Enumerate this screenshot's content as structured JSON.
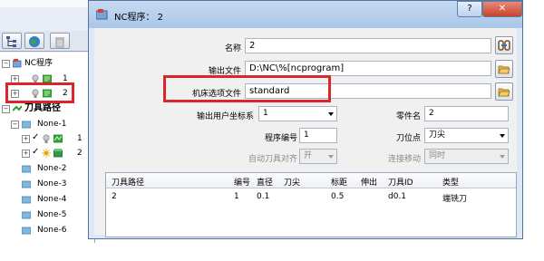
{
  "tree": {
    "root_label": "NC程序",
    "nc_items": [
      {
        "label": "1"
      },
      {
        "label": "2"
      }
    ],
    "toolpaths_label": "刀具路径",
    "toolpath_items": [
      {
        "label": "None-1",
        "children": [
          {
            "label": "1"
          },
          {
            "label": "2"
          }
        ]
      },
      {
        "label": "None-2"
      },
      {
        "label": "None-3"
      },
      {
        "label": "None-4"
      },
      {
        "label": "None-5"
      },
      {
        "label": "None-6"
      }
    ]
  },
  "dialog": {
    "title": "NC程序：   2",
    "help_label": "?",
    "close_label": "✕",
    "name_label": "名称",
    "name_value": "2",
    "output_file_label": "输出文件",
    "output_file_value": "D:\\NC\\%[ncprogram]",
    "machine_option_label": "机床选项文件",
    "machine_option_value": "standard",
    "user_coord_label": "输出用户坐标系",
    "user_coord_value": "1",
    "part_name_label": "零件名",
    "part_name_value": "2",
    "program_number_label": "程序编号",
    "program_number_value": "1",
    "tool_position_label": "刀位点",
    "tool_position_value": "刀尖",
    "auto_tool_align_label": "自动刀具对齐",
    "auto_tool_align_value": "开",
    "connect_move_label": "连接移动",
    "connect_move_value": "同时"
  },
  "table": {
    "columns": [
      "刀具路径",
      "编号",
      "直径",
      "刀尖",
      "标距",
      "伸出",
      "刀具ID",
      "类型"
    ],
    "rows": [
      [
        "2",
        "1",
        "0.1",
        "",
        "0.5",
        "",
        "d0.1",
        "端铣刀"
      ]
    ]
  },
  "colors": {
    "highlight_red": "#d9252b",
    "dialog_bg": "#dce8f5",
    "titlebar": "#b5cfee"
  }
}
